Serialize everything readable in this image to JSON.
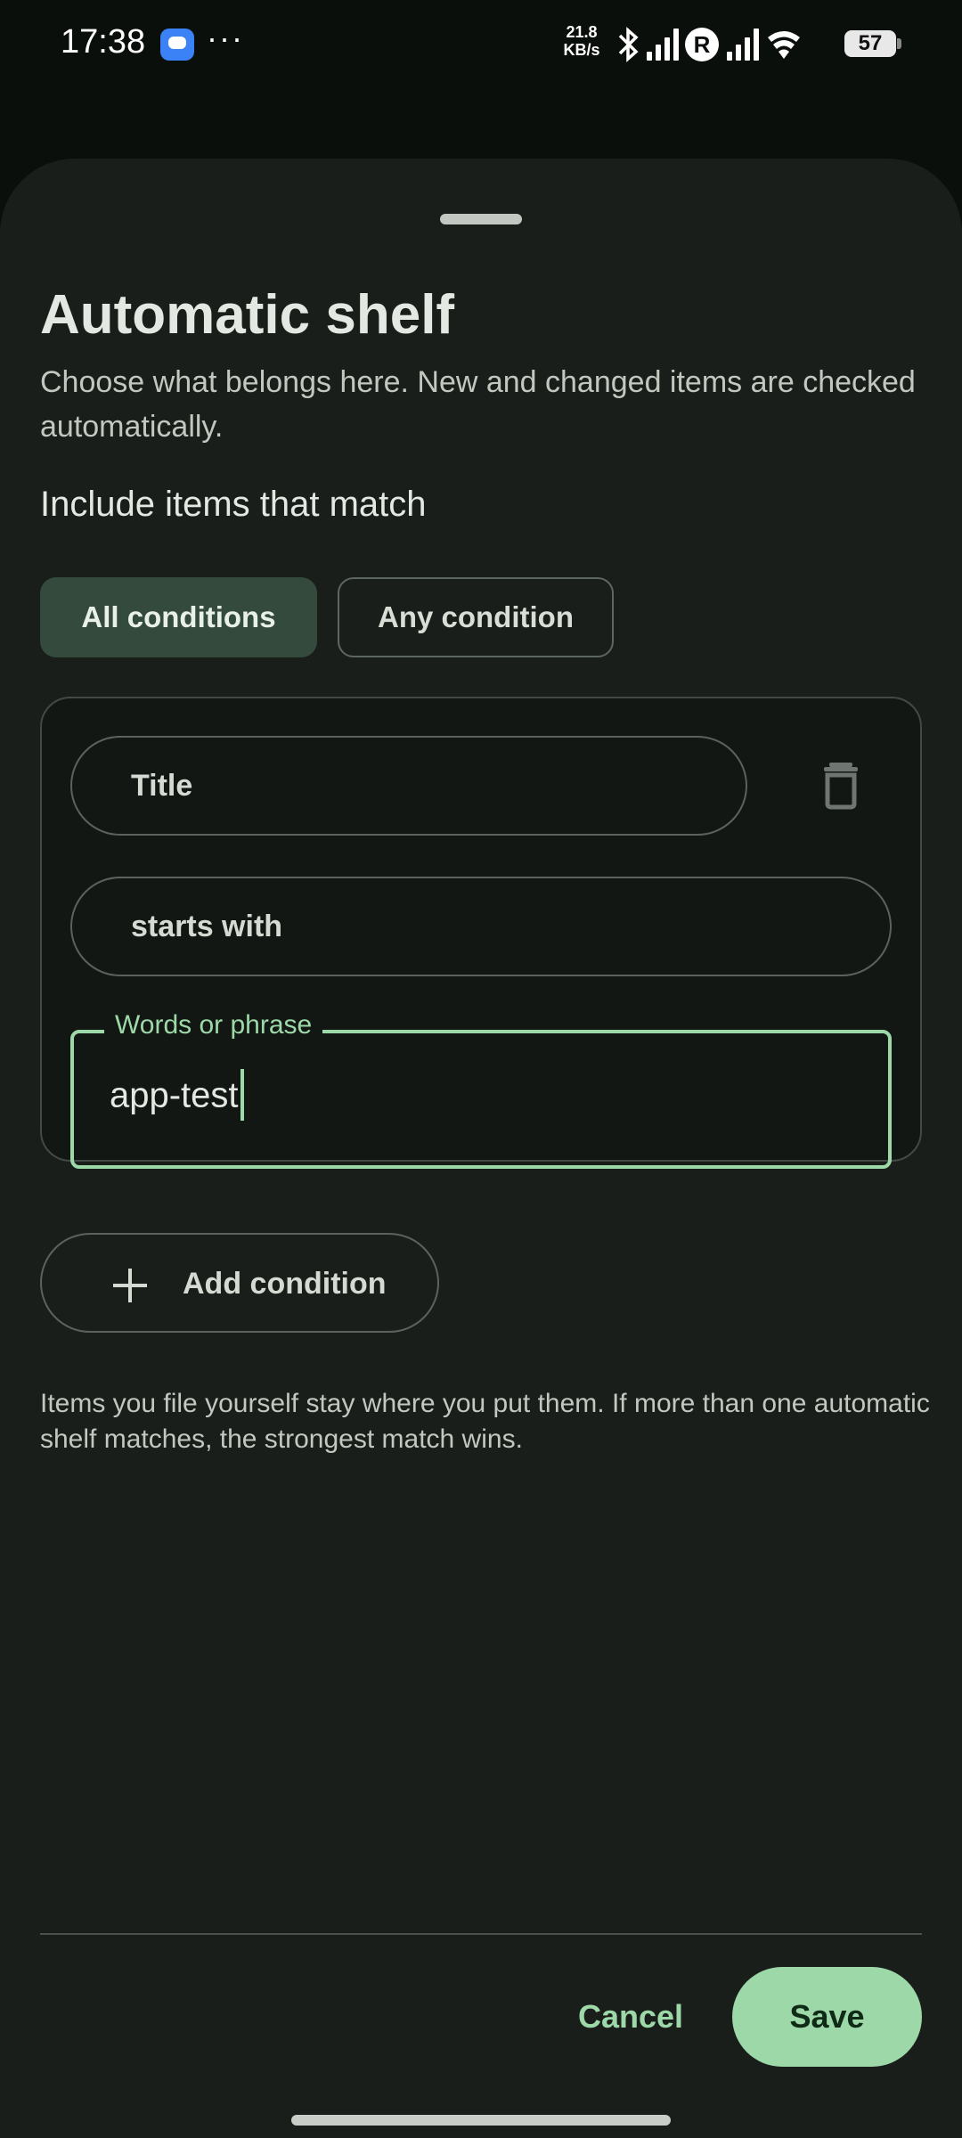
{
  "status_bar": {
    "time": "17:38",
    "dots": "···",
    "net_speed_value": "21.8",
    "net_speed_unit": "KB/s",
    "roaming_label": "R",
    "battery_level": "57",
    "icons": [
      "message-icon",
      "bluetooth-icon",
      "signal-icon",
      "roaming-icon",
      "signal-icon",
      "wifi-icon",
      "battery-icon"
    ]
  },
  "sheet": {
    "title": "Automatic shelf",
    "description": "Choose what belongs here. New and changed items are checked automatically.",
    "match_label": "Include items that match",
    "match_modes": [
      {
        "label": "All conditions",
        "selected": true
      },
      {
        "label": "Any condition",
        "selected": false
      }
    ],
    "condition": {
      "attribute": "Title",
      "operator": "starts with",
      "value_label": "Words or phrase",
      "value": "app-test"
    },
    "add_condition_label": "Add condition",
    "footnote": "Items you file yourself stay where you put them. If more than one automatic shelf matches, the strongest match wins.",
    "cancel_label": "Cancel",
    "save_label": "Save"
  },
  "colors": {
    "accent": "#9dd8a8",
    "sheet_bg": "#1a1e1b",
    "selected_segment": "#334a3c"
  }
}
